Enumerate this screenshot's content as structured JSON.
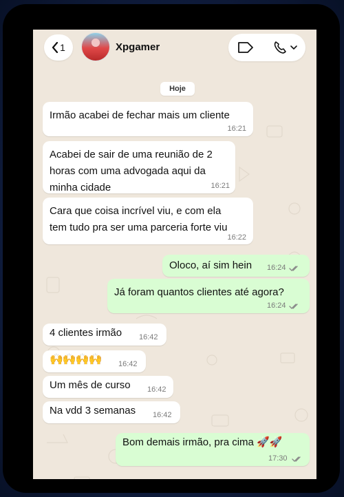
{
  "header": {
    "back_count": "1",
    "contact_name": "Xpgamer"
  },
  "date_label": "Hoje",
  "messages": [
    {
      "dir": "in",
      "text": "Irmão acabei de fechar mais um cliente",
      "time": "16:21"
    },
    {
      "dir": "in",
      "text": "Acabei de sair de uma reunião de 2\nhoras com uma advogada aqui da\nminha cidade",
      "time": "16:21"
    },
    {
      "dir": "in",
      "text": "Cara que coisa incrível viu, e com ela\ntem tudo pra ser uma parceria forte viu",
      "time": "16:22"
    },
    {
      "dir": "out",
      "text": "Oloco, aí sim hein",
      "time": "16:24"
    },
    {
      "dir": "out",
      "text": "Já foram quantos clientes até agora?",
      "time": "16:24"
    },
    {
      "dir": "in",
      "text": "4 clientes irmão",
      "time": "16:42"
    },
    {
      "dir": "in",
      "text": "🙌🙌🙌🙌",
      "time": "16:42"
    },
    {
      "dir": "in",
      "text": "Um mês de curso",
      "time": "16:42"
    },
    {
      "dir": "in",
      "text": "Na vdd 3 semanas",
      "time": "16:42"
    },
    {
      "dir": "out",
      "text": "Bom demais irmão, pra cima 🚀🚀",
      "time": "17:30"
    }
  ],
  "colors": {
    "chat_background": "#efe7dc",
    "incoming_bubble": "#ffffff",
    "outgoing_bubble": "#d9fdd3",
    "read_ticks": "#8a8a8a"
  }
}
